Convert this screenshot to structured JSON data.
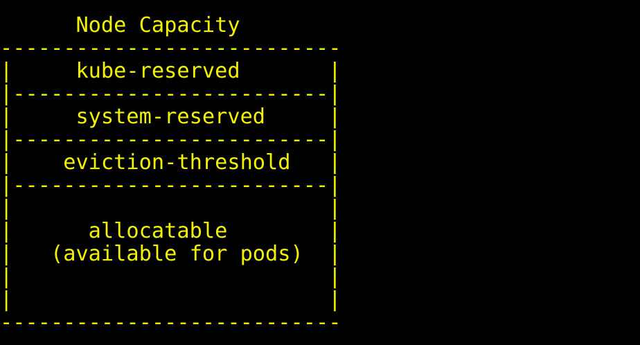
{
  "colors": {
    "background": "#000000",
    "text": "#f2f200"
  },
  "diagram": {
    "lines": [
      "      Node Capacity",
      "---------------------------",
      "|     kube-reserved       |",
      "|-------------------------|",
      "|     system-reserved     |",
      "|-------------------------|",
      "|    eviction-threshold   |",
      "|-------------------------|",
      "|                         |",
      "|      allocatable        |",
      "|   (available for pods)  |",
      "|                         |",
      "|                         |",
      "---------------------------"
    ]
  }
}
